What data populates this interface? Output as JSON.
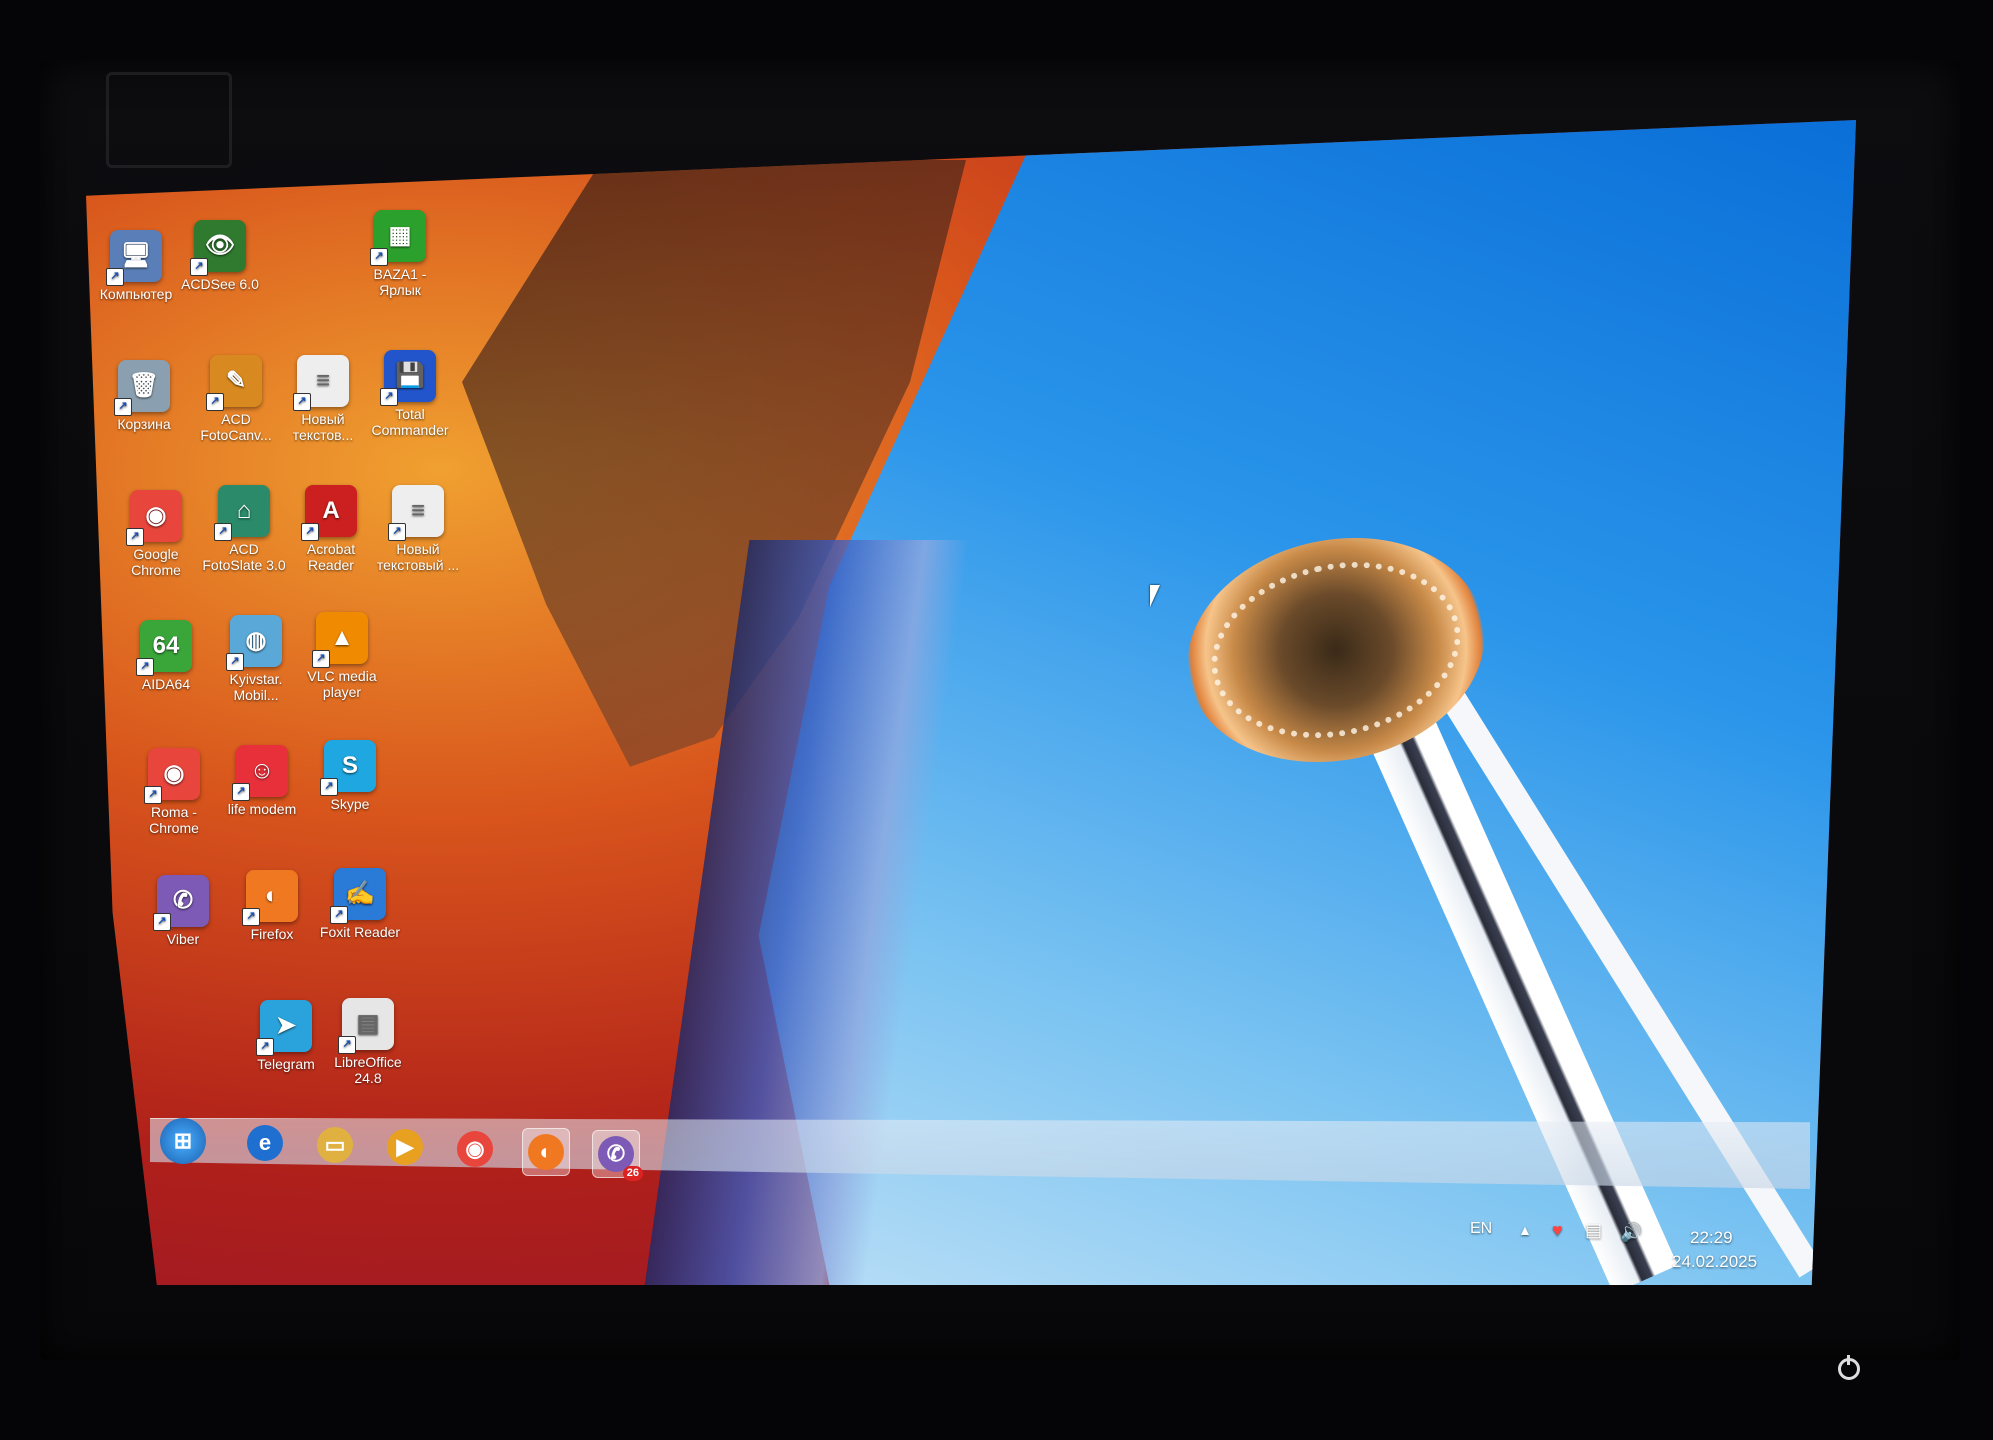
{
  "desktop": {
    "icons": [
      {
        "label": "Компьютер",
        "icon": "computer-icon",
        "color": "#5a7fb8",
        "glyph": "🖥"
      },
      {
        "label": "ACDSee 6.0",
        "icon": "acdsee-icon",
        "color": "#2f7a2f",
        "glyph": "👁"
      },
      {
        "label": "BAZA1 -\nЯрлык",
        "icon": "spreadsheet-icon",
        "color": "#2ca02c",
        "glyph": "▦"
      },
      {
        "label": "Корзина",
        "icon": "recycle-bin-icon",
        "color": "#8aa0b0",
        "glyph": "🗑"
      },
      {
        "label": "ACD\nFotoCanv...",
        "icon": "acd-fotocanvas-icon",
        "color": "#d88a20",
        "glyph": "✎"
      },
      {
        "label": "Новый\nтекстов...",
        "icon": "text-document-icon",
        "color": "#eeeeee",
        "glyph": "≡"
      },
      {
        "label": "Total\nCommander",
        "icon": "floppy-disk-icon",
        "color": "#2255cc",
        "glyph": "💾"
      },
      {
        "label": "Google\nChrome",
        "icon": "chrome-icon",
        "color": "#e8453c",
        "glyph": "◉"
      },
      {
        "label": "ACD\nFotoSlate 3.0",
        "icon": "acd-fotoslate-icon",
        "color": "#2a8a6a",
        "glyph": "⌂"
      },
      {
        "label": "Acrobat\nReader",
        "icon": "acrobat-icon",
        "color": "#cc1f1f",
        "glyph": "A"
      },
      {
        "label": "Новый\nтекстовый ...",
        "icon": "text-document-icon",
        "color": "#eeeeee",
        "glyph": "≡"
      },
      {
        "label": "AIDA64",
        "icon": "aida64-icon",
        "color": "#3aa63a",
        "glyph": "64"
      },
      {
        "label": "Kyivstar.\nMobil...",
        "icon": "globe-icon",
        "color": "#5aa8d8",
        "glyph": "◍"
      },
      {
        "label": "VLC media\nplayer",
        "icon": "vlc-cone-icon",
        "color": "#f08a00",
        "glyph": "▲"
      },
      {
        "label": "Roma -\nChrome",
        "icon": "chrome-profile-icon",
        "color": "#e8453c",
        "glyph": "◉"
      },
      {
        "label": "life modem",
        "icon": "life-modem-icon",
        "color": "#e8303a",
        "glyph": "☺"
      },
      {
        "label": "Skype",
        "icon": "skype-icon",
        "color": "#1ea7e1",
        "glyph": "S"
      },
      {
        "label": "Viber",
        "icon": "viber-icon",
        "color": "#7d5ab5",
        "glyph": "✆"
      },
      {
        "label": "Firefox",
        "icon": "firefox-icon",
        "color": "#f07820",
        "glyph": "◐"
      },
      {
        "label": "Foxit Reader",
        "icon": "foxit-icon",
        "color": "#2a7ad8",
        "glyph": "✍"
      },
      {
        "label": "Telegram",
        "icon": "telegram-icon",
        "color": "#2aa3dc",
        "glyph": "➤"
      },
      {
        "label": "LibreOffice\n24.8",
        "icon": "libreoffice-icon",
        "color": "#e6e6e6",
        "glyph": "▤"
      }
    ]
  },
  "taskbar": {
    "start": {
      "icon": "windows-start-icon",
      "glyph": "⊞"
    },
    "pinned": [
      {
        "icon": "internet-explorer-icon",
        "glyph": "e",
        "color": "#1f6fd0"
      },
      {
        "icon": "file-explorer-icon",
        "glyph": "▭",
        "color": "#e0b040"
      },
      {
        "icon": "media-player-icon",
        "glyph": "▶",
        "color": "#e8a020"
      },
      {
        "icon": "chrome-icon",
        "glyph": "◉",
        "color": "#e8453c"
      },
      {
        "icon": "firefox-icon",
        "glyph": "◐",
        "color": "#f07820"
      },
      {
        "icon": "viber-icon",
        "glyph": "✆",
        "color": "#7d5ab5",
        "badge": "26"
      }
    ],
    "tray": {
      "language": "EN",
      "time": "22:29",
      "date": "24.02.2025"
    }
  }
}
